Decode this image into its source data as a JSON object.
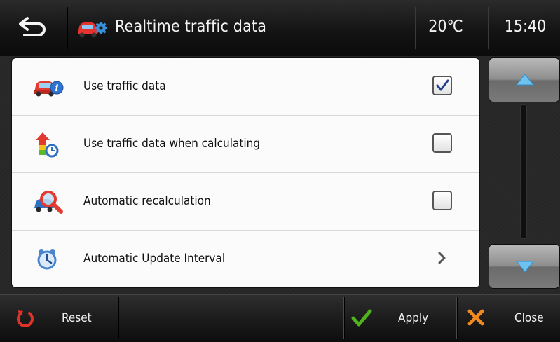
{
  "header": {
    "title": "Realtime traffic data",
    "temperature": "20℃",
    "time": "15:40",
    "back_icon": "back-arrow-icon",
    "title_icon": "car-settings-icon"
  },
  "settings": {
    "items": [
      {
        "label": "Use traffic data",
        "icon": "car-info-icon",
        "control": "checkbox",
        "checked": true
      },
      {
        "label": "Use traffic data when calculating",
        "icon": "arrow-clock-icon",
        "control": "checkbox",
        "checked": false
      },
      {
        "label": "Automatic recalculation",
        "icon": "car-search-icon",
        "control": "checkbox",
        "checked": false
      },
      {
        "label": "Automatic Update Interval",
        "icon": "alarm-clock-icon",
        "control": "chevron"
      }
    ]
  },
  "footer": {
    "reset_label": "Reset",
    "apply_label": "Apply",
    "close_label": "Close"
  },
  "colors": {
    "apply_check": "#4fb21d",
    "close_x": "#f08a1e",
    "reset_icon": "#e0322a",
    "checkmark": "#1f3f8a",
    "scroll_arrow": "#6fc2ee"
  }
}
